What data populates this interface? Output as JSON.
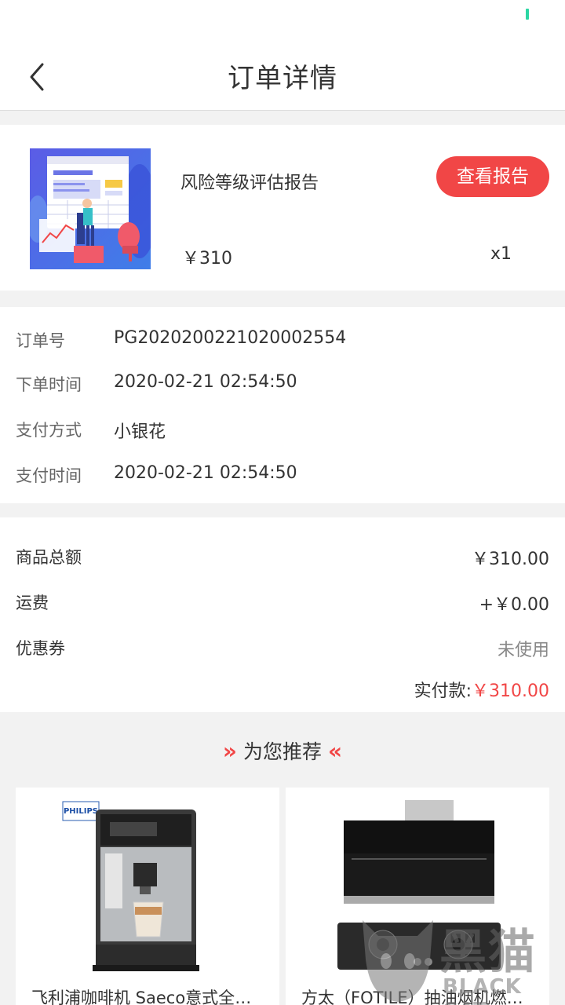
{
  "nav": {
    "title": "订单详情"
  },
  "product": {
    "name": "风险等级评估报告",
    "report_button": "查看报告",
    "price": "￥310",
    "quantity": "x1"
  },
  "order_info": [
    {
      "label": "订单号",
      "value": "PG2020200221020002554"
    },
    {
      "label": "下单时间",
      "value": "2020-02-21 02:54:50"
    },
    {
      "label": "支付方式",
      "value": "小银花"
    },
    {
      "label": "支付时间",
      "value": "2020-02-21 02:54:50"
    }
  ],
  "amounts": [
    {
      "label": "商品总额",
      "value": "￥310.00"
    },
    {
      "label": "运费",
      "value": "+￥0.00"
    },
    {
      "label": "优惠券",
      "value": "未使用"
    }
  ],
  "paid": {
    "label": "实付款:",
    "amount": "￥310.00"
  },
  "recommend": {
    "title": "为您推荐",
    "items": [
      {
        "name": "飞利浦咖啡机 Saeco意式全自动咖啡机",
        "brand": "PHILIPS"
      },
      {
        "name": "方太（FOTILE）抽油烟机燃气灶套装"
      }
    ]
  },
  "watermark": {
    "cn": "黑猫",
    "en": "BLACK CAT"
  },
  "colors": {
    "accent": "#f14646",
    "status_battery": "#2bd6a3"
  },
  "icons": {
    "back": "chevron-left-icon"
  }
}
